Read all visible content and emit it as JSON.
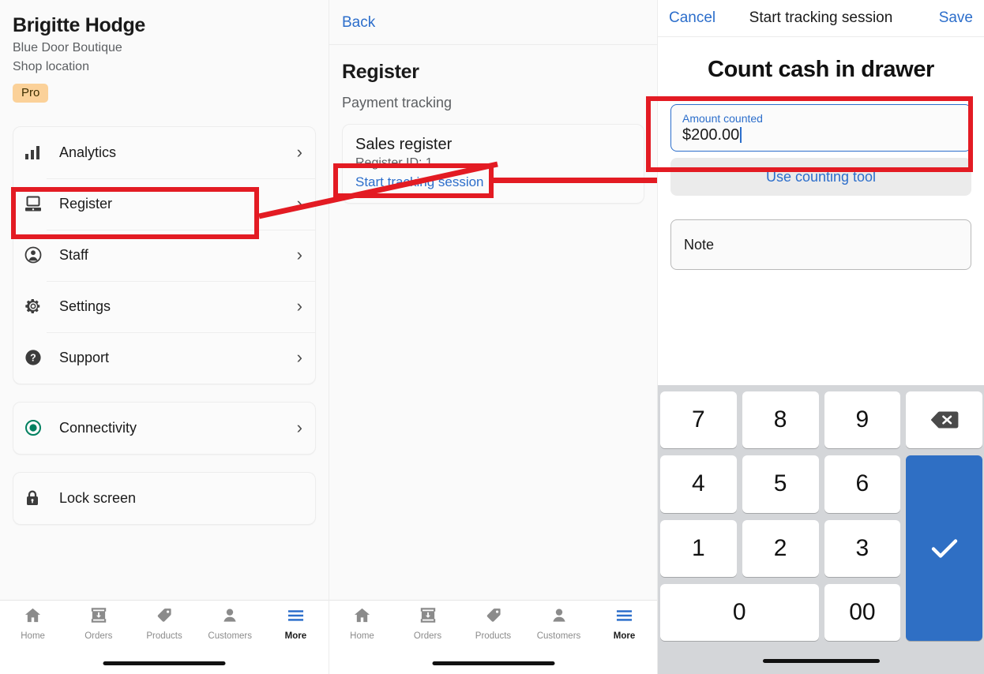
{
  "left_panel": {
    "profile": {
      "name": "Brigitte Hodge",
      "business": "Blue Door Boutique",
      "location": "Shop location",
      "badge": "Pro"
    },
    "menu_group_1": [
      {
        "label": "Analytics",
        "icon": "bar-chart-icon",
        "chevron": "›"
      },
      {
        "label": "Register",
        "icon": "register-icon",
        "chevron": "›"
      },
      {
        "label": "Staff",
        "icon": "person-circle-icon",
        "chevron": "›"
      },
      {
        "label": "Settings",
        "icon": "gear-icon",
        "chevron": "›"
      },
      {
        "label": "Support",
        "icon": "question-circle-icon",
        "chevron": "›"
      }
    ],
    "menu_group_2": [
      {
        "label": "Connectivity",
        "icon": "connectivity-dot-icon",
        "chevron": "›"
      }
    ],
    "menu_group_3": [
      {
        "label": "Lock screen",
        "icon": "lock-icon",
        "chevron": ""
      }
    ]
  },
  "mid_panel": {
    "back_label": "Back",
    "title": "Register",
    "subtitle": "Payment tracking",
    "register_card": {
      "name": "Sales register",
      "id_text": "Register ID: 1",
      "action": "Start tracking session"
    }
  },
  "right_panel": {
    "header": {
      "cancel": "Cancel",
      "title": "Start tracking session",
      "save": "Save"
    },
    "heading": "Count cash in drawer",
    "amount_field": {
      "label": "Amount counted",
      "value": "$200.00"
    },
    "counting_tool": "Use counting tool",
    "note_field": {
      "placeholder": "Note",
      "value": "Note"
    },
    "keypad": {
      "keys": [
        "7",
        "8",
        "9",
        "delete-icon",
        "4",
        "5",
        "6",
        "1",
        "2",
        "3",
        "0",
        "00",
        "check-icon"
      ],
      "enter_icon": "check-icon",
      "delete_icon": "backspace-icon"
    }
  },
  "tabbar": {
    "items": [
      {
        "label": "Home",
        "icon": "home-icon",
        "active": false
      },
      {
        "label": "Orders",
        "icon": "orders-icon",
        "active": false
      },
      {
        "label": "Products",
        "icon": "tag-icon",
        "active": false
      },
      {
        "label": "Customers",
        "icon": "person-icon",
        "active": false
      },
      {
        "label": "More",
        "icon": "hamburger-icon",
        "active": true
      }
    ]
  },
  "colors": {
    "accent_blue": "#2c6ecb",
    "annotation_red": "#e31b23",
    "pro_badge_bg": "#fbd199",
    "keypad_bg": "#d4d6d9",
    "enter_key_blue": "#2f6fc4",
    "connectivity_green": "#008060"
  }
}
